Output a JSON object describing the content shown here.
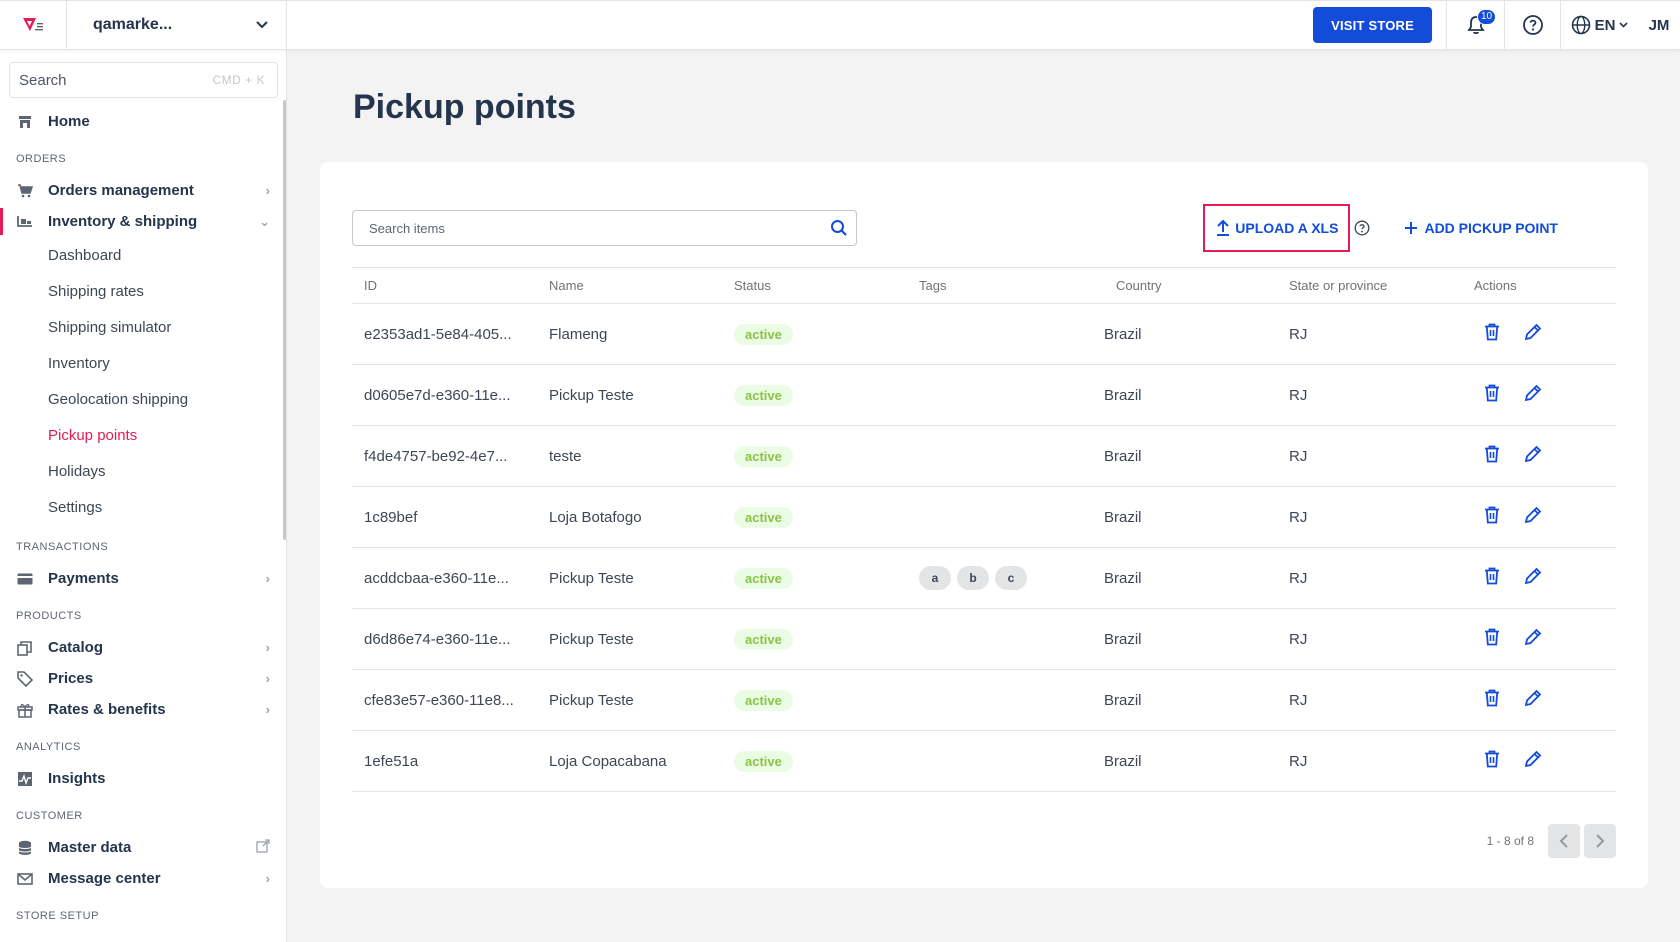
{
  "header": {
    "account_name": "qamarke...",
    "visit_store": "VISIT STORE",
    "notifications_count": "10",
    "language": "EN",
    "user_initials": "JM"
  },
  "sidebar": {
    "search_placeholder": "Search",
    "search_shortcut": "CMD + K",
    "home": "Home",
    "sections": {
      "orders": "ORDERS",
      "transactions": "TRANSACTIONS",
      "products": "PRODUCTS",
      "analytics": "ANALYTICS",
      "customer": "CUSTOMER",
      "store_setup": "STORE SETUP"
    },
    "orders_management": "Orders management",
    "inventory_shipping": "Inventory & shipping",
    "inventory_sub": [
      "Dashboard",
      "Shipping rates",
      "Shipping simulator",
      "Inventory",
      "Geolocation shipping",
      "Pickup points",
      "Holidays",
      "Settings"
    ],
    "payments": "Payments",
    "catalog": "Catalog",
    "prices": "Prices",
    "rates_benefits": "Rates & benefits",
    "insights": "Insights",
    "master_data": "Master data",
    "message_center": "Message center"
  },
  "page": {
    "title": "Pickup points",
    "search_placeholder": "Search items",
    "upload_label": "UPLOAD A XLS",
    "add_label": "ADD PICKUP POINT",
    "columns": [
      "ID",
      "Name",
      "Status",
      "Tags",
      "Country",
      "State or province",
      "Actions"
    ],
    "rows": [
      {
        "id": "e2353ad1-5e84-405...",
        "name": "Flameng",
        "status": "active",
        "tags": [],
        "country": "Brazil",
        "state": "RJ"
      },
      {
        "id": "d0605e7d-e360-11e...",
        "name": "Pickup Teste",
        "status": "active",
        "tags": [],
        "country": "Brazil",
        "state": "RJ"
      },
      {
        "id": "f4de4757-be92-4e7...",
        "name": "teste",
        "status": "active",
        "tags": [],
        "country": "Brazil",
        "state": "RJ"
      },
      {
        "id": "1c89bef",
        "name": "Loja Botafogo",
        "status": "active",
        "tags": [],
        "country": "Brazil",
        "state": "RJ"
      },
      {
        "id": "acddcbaa-e360-11e...",
        "name": "Pickup Teste",
        "status": "active",
        "tags": [
          "a",
          "b",
          "c"
        ],
        "country": "Brazil",
        "state": "RJ"
      },
      {
        "id": "d6d86e74-e360-11e...",
        "name": "Pickup Teste",
        "status": "active",
        "tags": [],
        "country": "Brazil",
        "state": "RJ"
      },
      {
        "id": "cfe83e57-e360-11e8...",
        "name": "Pickup Teste",
        "status": "active",
        "tags": [],
        "country": "Brazil",
        "state": "RJ"
      },
      {
        "id": "1efe51a",
        "name": "Loja Copacabana",
        "status": "active",
        "tags": [],
        "country": "Brazil",
        "state": "RJ"
      }
    ],
    "pagination": "1 - 8 of 8"
  },
  "colors": {
    "brand_pink": "#e31c58",
    "primary_blue": "#134cd8",
    "status_green": "#8bc34a"
  }
}
